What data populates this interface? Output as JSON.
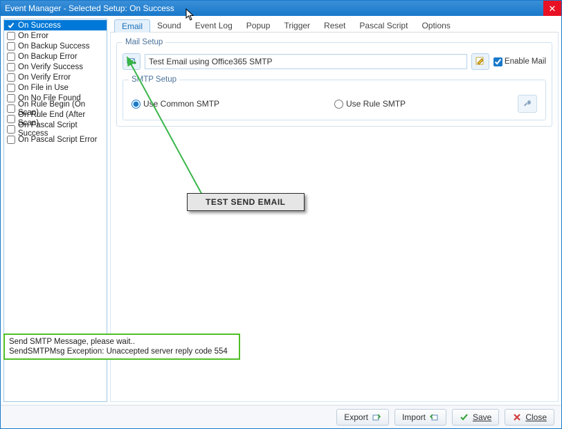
{
  "window": {
    "title": "Event Manager - Selected Setup: On Success"
  },
  "sidebar": {
    "items": [
      {
        "label": "On Success",
        "checked": true,
        "selected": true
      },
      {
        "label": "On Error",
        "checked": false
      },
      {
        "label": "On Backup Success",
        "checked": false
      },
      {
        "label": "On Backup Error",
        "checked": false
      },
      {
        "label": "On Verify Success",
        "checked": false
      },
      {
        "label": "On Verify Error",
        "checked": false
      },
      {
        "label": "On File in Use",
        "checked": false
      },
      {
        "label": "On No File Found",
        "checked": false
      },
      {
        "label": "On Rule Begin (On Scan)",
        "checked": false
      },
      {
        "label": "On Rule End (After Scan)",
        "checked": false
      },
      {
        "label": "On Pascal Script Success",
        "checked": false
      },
      {
        "label": "On Pascal Script Error",
        "checked": false
      }
    ]
  },
  "tabs": {
    "items": [
      "Email",
      "Sound",
      "Event Log",
      "Popup",
      "Trigger",
      "Reset",
      "Pascal Script",
      "Options"
    ],
    "active_index": 0
  },
  "mail": {
    "fieldset_title": "Mail Setup",
    "test_value": "Test Email using Office365 SMTP",
    "enable_label": "Enable Mail",
    "enable_checked": true,
    "smtp_fieldset": "SMTP Setup",
    "radio_common": "Use Common SMTP",
    "radio_rule": "Use Rule SMTP",
    "radio_selected": "common",
    "callout": "TEST SEND EMAIL"
  },
  "status": {
    "line1": "Send SMTP Message, please wait..",
    "line2": "SendSMTPMsg Exception: Unaccepted server reply code 554"
  },
  "buttons": {
    "export": "Export",
    "import": "Import",
    "save": "Save",
    "close": "Close"
  }
}
